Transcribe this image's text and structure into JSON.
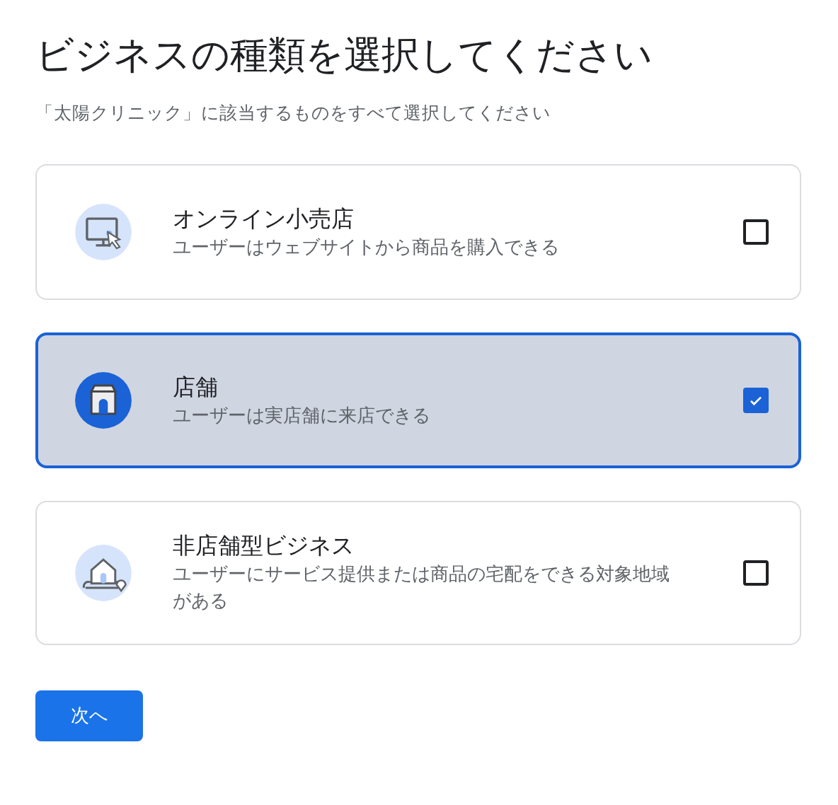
{
  "title": "ビジネスの種類を選択してください",
  "subtitle": "「太陽クリニック」に該当するものをすべて選択してください",
  "options": [
    {
      "kind": "online",
      "title": "オンライン小売店",
      "description": "ユーザーはウェブサイトから商品を購入できる",
      "selected": false
    },
    {
      "kind": "store",
      "title": "店舗",
      "description": "ユーザーは実店舗に来店できる",
      "selected": true
    },
    {
      "kind": "service",
      "title": "非店舗型ビジネス",
      "description": "ユーザーにサービス提供または商品の宅配をできる対象地域がある",
      "selected": false
    }
  ],
  "next_button": "次へ"
}
